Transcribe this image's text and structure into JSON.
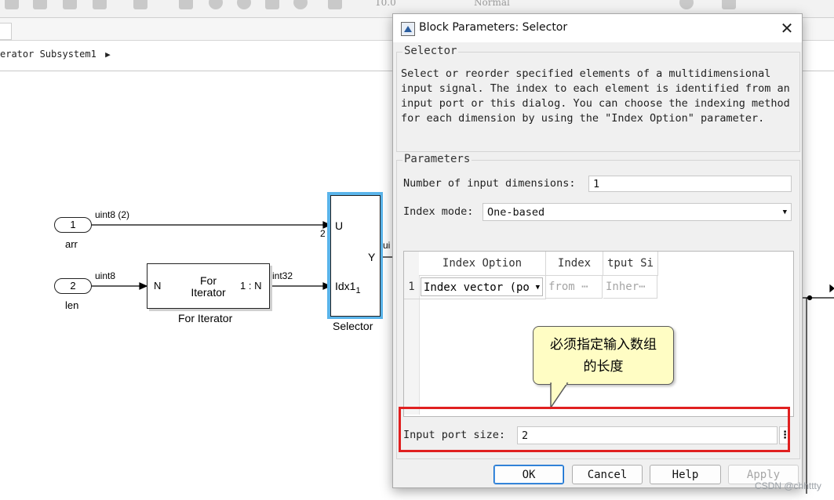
{
  "toolbar": {
    "sim_time": "10.0",
    "sim_mode": "Normal"
  },
  "breadcrumb": {
    "path_tail": "erator Subsystem1"
  },
  "canvas": {
    "port_arr": {
      "number": "1",
      "name": "arr",
      "signal": "uint8 (2)"
    },
    "port_len": {
      "number": "2",
      "name": "len",
      "signal": "uint8"
    },
    "for_iterator": {
      "port_in": "N",
      "line1": "For",
      "line2": "Iterator",
      "port_out": "1 : N",
      "name": "For Iterator",
      "out_signal": "int32"
    },
    "selector": {
      "port_u": "U",
      "port_idx": "Idx1",
      "idx_sub": "1",
      "port_y": "Y",
      "name": "Selector",
      "width_label": "2",
      "out_signal": "ui"
    }
  },
  "dialog": {
    "title": "Block Parameters: Selector",
    "close_glyph": "✕",
    "group_block": "Selector",
    "description": "Select or reorder specified elements of a multidimensional input signal. The index to each element is identified from an input port or this dialog. You can choose the indexing method for each dimension by using the \"Index Option\" parameter.",
    "group_params": "Parameters",
    "num_dims_label": "Number of input dimensions:",
    "num_dims_value": "1",
    "index_mode_label": "Index mode:",
    "index_mode_value": "One-based",
    "table": {
      "headers": [
        "Index Option",
        "Index",
        "tput Si"
      ],
      "rows": [
        {
          "row": "1",
          "option": "Index vector (po",
          "index": "from ⋯",
          "output_size": "Inher⋯"
        }
      ]
    },
    "input_port_size_label": "Input port size:",
    "input_port_size_value": "2",
    "buttons": {
      "ok": "OK",
      "cancel": "Cancel",
      "help": "Help",
      "apply": "Apply"
    }
  },
  "annotation": {
    "callout_text": "必须指定输入数组的长度"
  },
  "watermark": "CSDN @chhttty",
  "colors": {
    "selector_highlight": "#5ab4ea",
    "annotation_box": "#e02020",
    "callout_fill": "#fffdc4"
  }
}
